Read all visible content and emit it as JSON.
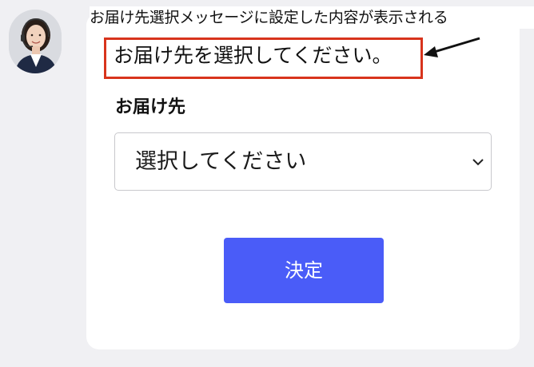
{
  "annotation": {
    "text": "お届け先選択メッセージに設定した内容が表示される"
  },
  "message": {
    "text": "お届け先を選択してください。"
  },
  "form": {
    "field_label": "お届け先",
    "select_value": "選択してください",
    "submit_label": "決定"
  },
  "icons": {
    "avatar": "operator-avatar-icon",
    "arrow": "pointer-arrow-icon",
    "chevron": "chevron-down-icon"
  },
  "colors": {
    "button": "#4a5cf8",
    "highlight_border": "#d8341c",
    "background": "#f0f0f3"
  }
}
